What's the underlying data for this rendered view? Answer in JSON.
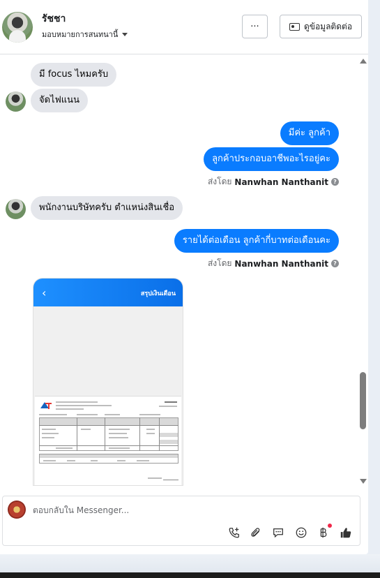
{
  "header": {
    "contact_name": "รัชชา",
    "assign_text": "มอบหมายการสนทนานี้",
    "more_label": "···",
    "contact_info_label": "ดูข้อมูลติดต่อ"
  },
  "messages": [
    {
      "dir": "in",
      "text": "มี focus ไหมครับ"
    },
    {
      "dir": "in",
      "text": "จัดไฟแนน"
    },
    {
      "dir": "out",
      "text": "มีค่ะ ลูกค้า"
    },
    {
      "dir": "out",
      "text": "ลูกค้าประกอบอาชีพอะไรอยู่คะ"
    },
    {
      "dir": "in",
      "text": "พนักงานบริษัทครับ ตำแหน่งสินเชื่อ"
    },
    {
      "dir": "out",
      "text": "รายได้ต่อเดือน ลูกค้ากี่บาทต่อเดือนคะ"
    }
  ],
  "sent_by": {
    "prefix": "ส่งโดย",
    "name": "Nanwhan Nanthanit",
    "help_icon": "question-circle-icon"
  },
  "attachment": {
    "header_title": "สรุปเงินเดือน",
    "back_icon": "chevron-left-icon"
  },
  "composer": {
    "placeholder": "ตอบกลับใน Messenger...",
    "tools": [
      "call-add-icon",
      "paperclip-icon",
      "chat-bubble-icon",
      "emoji-icon",
      "baht-icon",
      "thumbs-up-icon"
    ]
  },
  "colors": {
    "outgoing_bubble": "#0a7cff",
    "incoming_bubble": "#e4e6eb",
    "notification_dot": "#f02849"
  }
}
